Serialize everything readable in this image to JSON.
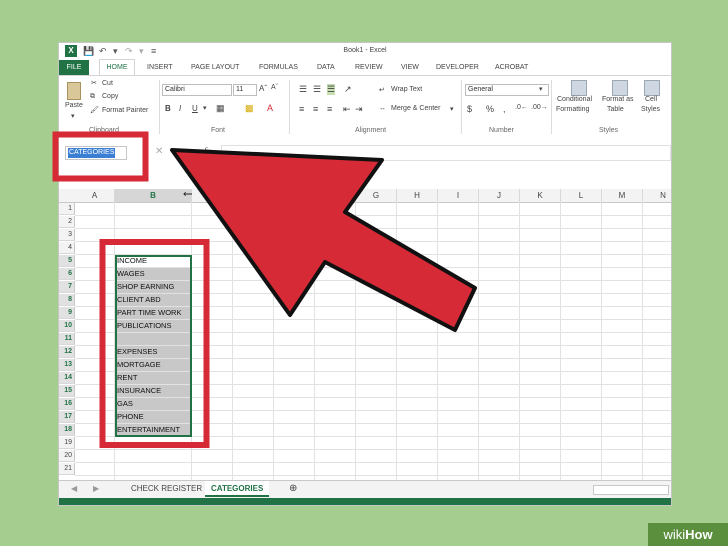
{
  "window": {
    "title": "Book1 - Excel"
  },
  "quick_access": {
    "save_icon": "save-icon",
    "undo_icon": "undo-icon",
    "redo_icon": "redo-icon"
  },
  "tabs": [
    "FILE",
    "HOME",
    "INSERT",
    "PAGE LAYOUT",
    "FORMULAS",
    "DATA",
    "REVIEW",
    "VIEW",
    "DEVELOPER",
    "ACROBAT"
  ],
  "active_tab": "HOME",
  "ribbon": {
    "clipboard": {
      "paste": "Paste",
      "cut": "Cut",
      "copy": "Copy",
      "format_painter": "Format Painter",
      "label": "Clipboard"
    },
    "font": {
      "name": "Calibri",
      "size": "11",
      "bold": "B",
      "italic": "I",
      "underline": "U",
      "label": "Font"
    },
    "alignment": {
      "wrap_text": "Wrap Text",
      "merge_center": "Merge & Center",
      "label": "Alignment"
    },
    "number": {
      "format": "General",
      "currency": "$",
      "percent": "%",
      "comma": ",",
      "label": "Number"
    },
    "styles": {
      "conditional": "Conditional",
      "formatting": "Formatting",
      "format_as": "Format as",
      "table": "Table",
      "cell": "Cell",
      "styles_btn": "Styles",
      "label": "Styles"
    }
  },
  "formula_bar": {
    "name_box": "CATEGORIES",
    "fx": "fx"
  },
  "columns": [
    "A",
    "B",
    "C",
    "D",
    "E",
    "F",
    "G",
    "H",
    "I",
    "J",
    "K",
    "L",
    "M",
    "N"
  ],
  "rows": [
    "1",
    "2",
    "3",
    "4",
    "5",
    "6",
    "7",
    "8",
    "9",
    "10",
    "11",
    "12",
    "13",
    "14",
    "15",
    "16",
    "17",
    "18",
    "19",
    "20",
    "21"
  ],
  "column_b": [
    "",
    "",
    "",
    "",
    "INCOME",
    "WAGES",
    "SHOP EARNING",
    "CLIENT ABD",
    "PART TIME WORK",
    "PUBLICATIONS",
    "",
    "EXPENSES",
    "MORTGAGE",
    "RENT",
    "INSURANCE",
    "GAS",
    "PHONE",
    "ENTERTAINMENT",
    "",
    "",
    ""
  ],
  "sheets": [
    "CHECK REGISTER",
    "CATEGORIES"
  ],
  "active_sheet": "CATEGORIES",
  "watermark": {
    "wiki": "wiki",
    "how": "How"
  },
  "colors": {
    "excel_green": "#217346",
    "annotation_red": "#d62a36",
    "background": "#a4cd8f"
  }
}
